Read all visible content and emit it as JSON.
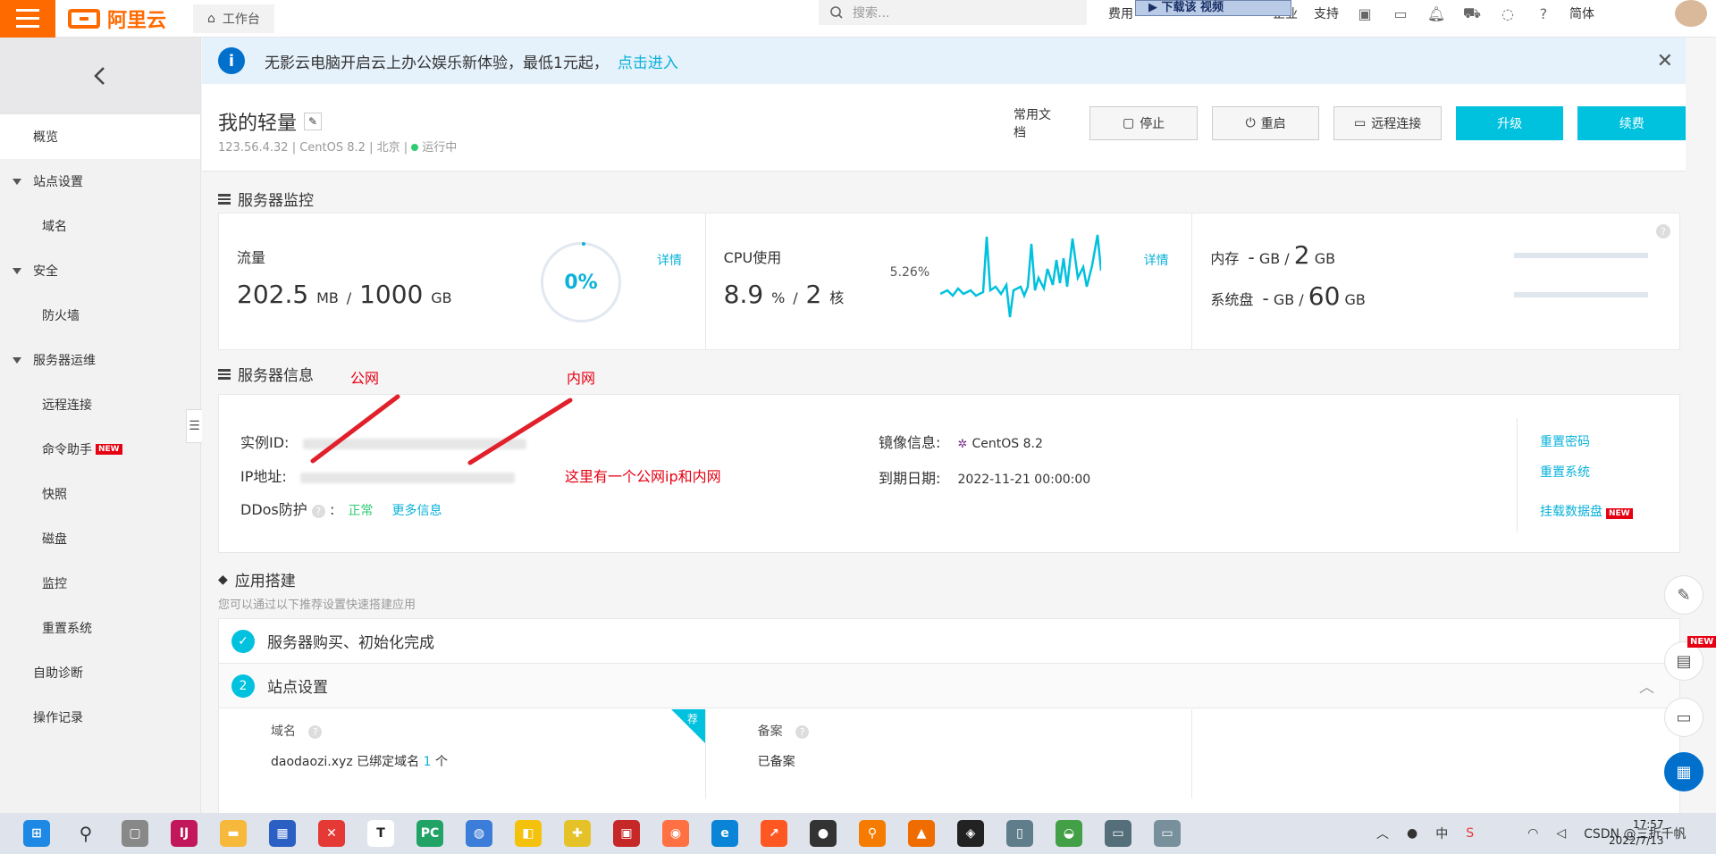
{
  "topbar": {
    "logo_text": "阿里云",
    "workbench_label": "工作台",
    "search_placeholder": "搜索...",
    "items": [
      "费用",
      "企业",
      "支持"
    ],
    "lang_label": "简体",
    "download_banner": "▶ 下载该 视频"
  },
  "sidebar": {
    "items": [
      {
        "label": "概览",
        "type": "item"
      },
      {
        "label": "站点设置",
        "type": "group"
      },
      {
        "label": "域名",
        "type": "sub"
      },
      {
        "label": "安全",
        "type": "group"
      },
      {
        "label": "防火墙",
        "type": "sub"
      },
      {
        "label": "服务器运维",
        "type": "group"
      },
      {
        "label": "远程连接",
        "type": "sub"
      },
      {
        "label": "命令助手",
        "type": "sub"
      },
      {
        "label": "快照",
        "type": "sub"
      },
      {
        "label": "磁盘",
        "type": "sub"
      },
      {
        "label": "监控",
        "type": "sub"
      },
      {
        "label": "重置系统",
        "type": "sub"
      },
      {
        "label": "自助诊断",
        "type": "item"
      },
      {
        "label": "操作记录",
        "type": "item"
      }
    ],
    "new_badge": "NEW"
  },
  "notice": {
    "text": "无影云电脑开启云上办公娱乐新体验，最低1元起，",
    "link": "点击进入"
  },
  "header": {
    "title": "我的轻量",
    "ip": "123.56.4.32",
    "os": "CentOS 8.2",
    "region": "北京",
    "status": "运行中",
    "docs_label": "常用文档",
    "stop_label": "停止",
    "restart_label": "重启",
    "remote_label": "远程连接",
    "upgrade_label": "升级",
    "renew_label": "续费"
  },
  "monitor": {
    "section_title": "服务器监控",
    "traffic_label": "流量",
    "traffic_used": "202.5",
    "traffic_used_unit": "MB",
    "traffic_total": "1000",
    "traffic_total_unit": "GB",
    "traffic_percent": "0%",
    "detail_label": "详情",
    "cpu_label": "CPU使用",
    "cpu_usage": "8.9",
    "cpu_unit": "%",
    "cpu_cores": "2",
    "cpu_cores_unit": "核",
    "cpu_peak": "5.26%",
    "mem_label": "内存",
    "mem_used": "-",
    "mem_total": "2",
    "disk_label": "系统盘",
    "disk_used": "-",
    "disk_total": "60",
    "unit_gb": "GB"
  },
  "server_info": {
    "section_title": "服务器信息",
    "instance_label": "实例ID:",
    "ip_label": "IP地址:",
    "ddos_label": "DDos防护",
    "ddos_status": "正常",
    "more_info": "更多信息",
    "image_label": "镜像信息:",
    "image_value": "CentOS 8.2",
    "expire_label": "到期日期:",
    "expire_value": "2022-11-21 00:00:00",
    "reset_password": "重置密码",
    "reset_system": "重置系统",
    "mount_disk": "挂载数据盘",
    "annot_public": "公网",
    "annot_private": "内网",
    "annot_note": "这里有一个公网ip和内网"
  },
  "app": {
    "section_title": "应用搭建",
    "subtitle": "您可以通过以下推荐设置快速搭建应用",
    "step1": "服务器购买、初始化完成",
    "step2_num": "2",
    "step2": "站点设置",
    "domain_label": "域名",
    "domain_value": "daodaozi.xyz 已绑定域名",
    "domain_count": "1",
    "domain_count_unit": "个",
    "recommend": "荐",
    "beian_label": "备案",
    "beian_value": "已备案"
  },
  "taskbar": {
    "time": "17:57",
    "date": "2022/7/13",
    "ime": "中",
    "watermark": "CSDN @三折千帆"
  }
}
